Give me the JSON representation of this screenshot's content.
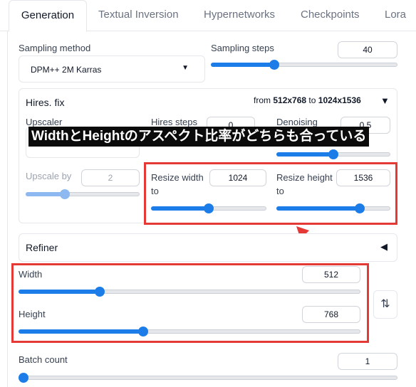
{
  "tabs": [
    "Generation",
    "Textual Inversion",
    "Hypernetworks",
    "Checkpoints",
    "Lora"
  ],
  "sampling": {
    "method_label": "Sampling method",
    "method_value": "DPM++ 2M Karras",
    "steps_label": "Sampling steps",
    "steps_value": "40",
    "steps_fraction": 0.33
  },
  "hires": {
    "title": "Hires. fix",
    "from_label": "from",
    "from_size": "512x768",
    "to_label": "to",
    "to_size": "1024x1536",
    "toggle_icon": "▼",
    "upscaler_label": "Upscaler",
    "hires_steps_label": "Hires steps",
    "hires_steps_value": "0",
    "denoising_label": "Denoising",
    "denoising_value": "0.5",
    "denoising_fraction": 0.5,
    "upscale_by_label": "Upscale by",
    "upscale_by_value": "2",
    "upscale_by_fraction": 0.33,
    "resize_width_label": "Resize width to",
    "resize_width_value": "1024",
    "resize_width_fraction": 0.5,
    "resize_height_label": "Resize height to",
    "resize_height_value": "1536",
    "resize_height_fraction": 0.75
  },
  "annotation": {
    "caption": "WidthとHeightのアスペクト比率がどちらも合っている"
  },
  "refiner": {
    "title": "Refiner",
    "toggle_icon": "◀"
  },
  "size": {
    "width_label": "Width",
    "width_value": "512",
    "width_fraction": 0.23,
    "height_label": "Height",
    "height_value": "768",
    "height_fraction": 0.36,
    "swap_icon": "⇅"
  },
  "batch": {
    "label": "Batch count",
    "value": "1",
    "fraction": 0.0
  }
}
